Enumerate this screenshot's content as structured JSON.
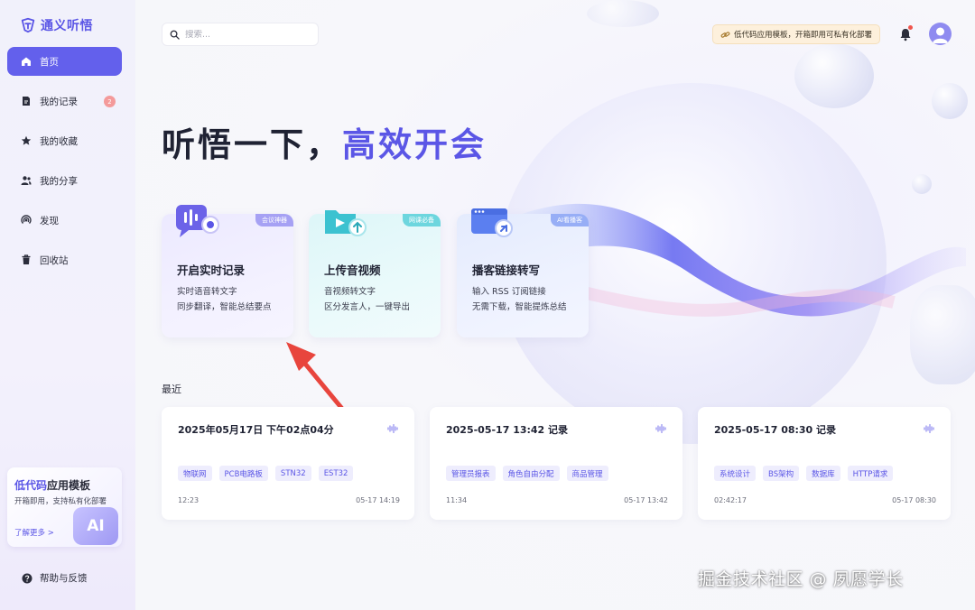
{
  "app": {
    "logo_text": "通义听悟"
  },
  "sidebar": {
    "items": [
      {
        "label": "首页",
        "icon": "home-icon",
        "active": true
      },
      {
        "label": "我的记录",
        "icon": "document-icon",
        "badge": "2"
      },
      {
        "label": "我的收藏",
        "icon": "star-icon"
      },
      {
        "label": "我的分享",
        "icon": "users-icon"
      },
      {
        "label": "发现",
        "icon": "discover-icon"
      },
      {
        "label": "回收站",
        "icon": "trash-icon"
      }
    ],
    "promo": {
      "title_a": "低代码",
      "title_b": "应用模板",
      "subtitle": "开箱即用，支持私有化部署",
      "link": "了解更多 >",
      "badge": "AI"
    },
    "help_label": "帮助与反馈"
  },
  "header": {
    "search_placeholder": "搜索...",
    "template_pill": "低代码应用模板，开箱即用可私有化部署",
    "accent_color": "#5b56e6"
  },
  "hero": {
    "title_a": "听悟一下，",
    "title_b": "高效开会"
  },
  "features": [
    {
      "tag": "会议神器",
      "title": "开启实时记录",
      "line1": "实时语音转文字",
      "line2": "同步翻译，智能总结要点",
      "icon": "microphone-record-icon"
    },
    {
      "tag": "网课必备",
      "title": "上传音视频",
      "line1": "音视频转文字",
      "line2": "区分发言人，一键导出",
      "icon": "upload-video-icon"
    },
    {
      "tag": "AI看播客",
      "title": "播客链接转写",
      "line1": "输入 RSS 订阅链接",
      "line2": "无需下载，智能提炼总结",
      "icon": "podcast-link-icon"
    }
  ],
  "recent": {
    "label": "最近",
    "cards": [
      {
        "title": "2025年05月17日 下午02点04分",
        "tags": [
          "物联网",
          "PCB电路板",
          "STN32",
          "EST32"
        ],
        "duration": "12:23",
        "time": "05-17 14:19"
      },
      {
        "title": "2025-05-17 13:42 记录",
        "tags": [
          "管理员报表",
          "角色自由分配",
          "商品管理"
        ],
        "duration": "11:34",
        "time": "05-17 13:42"
      },
      {
        "title": "2025-05-17 08:30 记录",
        "tags": [
          "系统设计",
          "BS架构",
          "数据库",
          "HTTP请求"
        ],
        "duration": "02:42:17",
        "time": "05-17 08:30"
      }
    ]
  },
  "watermark": "掘金技术社区 @ 夙愿学长"
}
